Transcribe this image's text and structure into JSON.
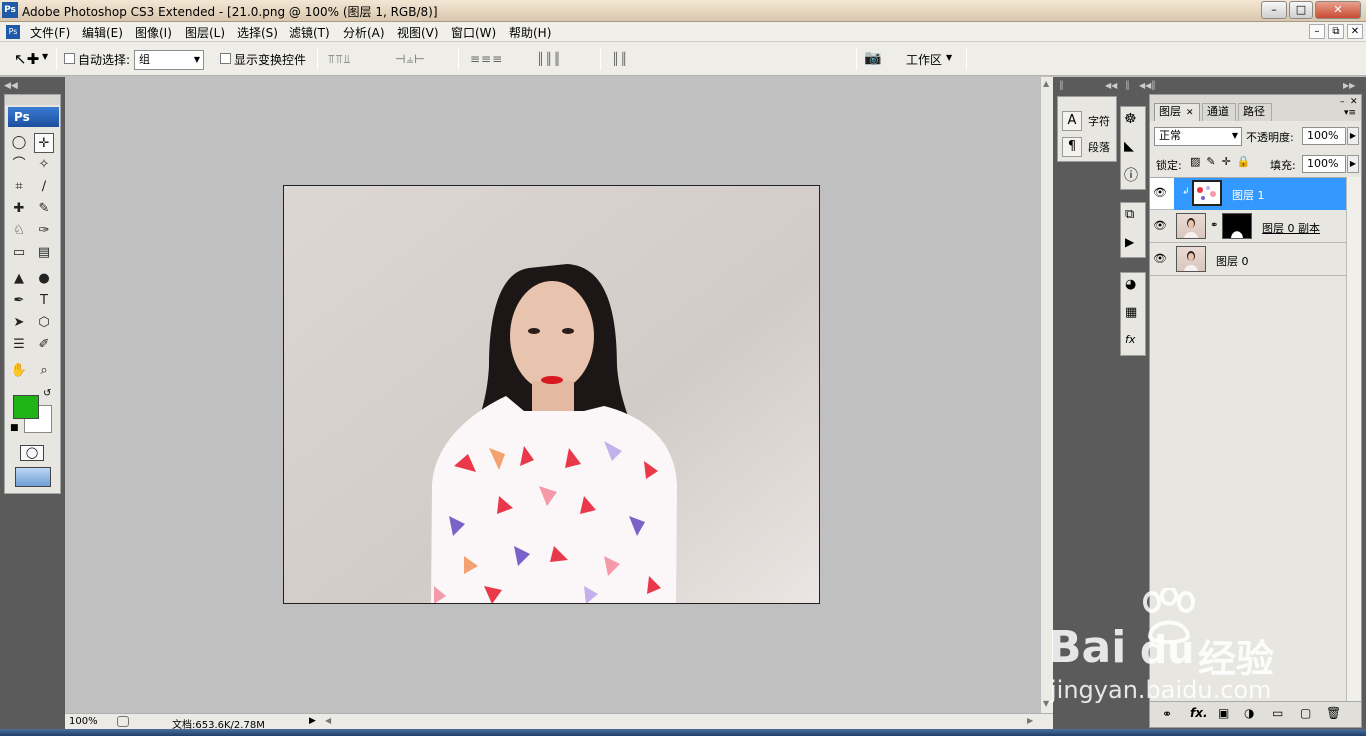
{
  "window": {
    "title": "Adobe Photoshop CS3 Extended - [21.0.png @ 100% (图层 1, RGB/8)]",
    "minimize": "–",
    "maximize": "□",
    "close": "✕"
  },
  "menu": [
    "文件(F)",
    "编辑(E)",
    "图像(I)",
    "图层(L)",
    "选择(S)",
    "滤镜(T)",
    "分析(A)",
    "视图(V)",
    "窗口(W)",
    "帮助(H)"
  ],
  "doc_controls": {
    "minimize": "–",
    "restore": "⧉",
    "close": "✕"
  },
  "options": {
    "auto_select_label": "自动选择:",
    "auto_select_value": "组",
    "show_transform_label": "显示变换控件",
    "workspace_label": "工作区"
  },
  "toolbox": {
    "ps_label": "Ps"
  },
  "tool_icons": [
    "marquee-icon",
    "move-icon",
    "lasso-icon",
    "magic-wand-icon",
    "crop-icon",
    "slice-icon",
    "healing-icon",
    "brush-icon",
    "stamp-icon",
    "history-brush-icon",
    "eraser-icon",
    "gradient-icon",
    "blur-icon",
    "dodge-icon",
    "pen-icon",
    "type-icon",
    "path-select-icon",
    "shape-icon",
    "notes-icon",
    "eyedropper-icon",
    "hand-icon",
    "zoom-icon"
  ],
  "colors": {
    "foreground": "#1fb316",
    "background": "#ffffff",
    "selection": "#3399ff"
  },
  "status": {
    "zoom": "100%",
    "doc_info": "文档:653.6K/2.78M"
  },
  "side_panel": {
    "character": "字符",
    "paragraph": "段落"
  },
  "layers_panel": {
    "tabs": [
      "图层",
      "通道",
      "路径"
    ],
    "blend_mode": "正常",
    "opacity_label": "不透明度:",
    "opacity_value": "100%",
    "lock_label": "锁定:",
    "fill_label": "填充:",
    "fill_value": "100%",
    "layers": [
      {
        "name": "图层 1",
        "selected": true
      },
      {
        "name": "图层 0 副本",
        "selected": false
      },
      {
        "name": "图层 0",
        "selected": false
      }
    ],
    "footer_icons": [
      "link-icon",
      "fx-icon",
      "mask-icon",
      "adjustment-icon",
      "group-icon",
      "new-layer-icon",
      "trash-icon"
    ]
  },
  "watermark": {
    "brand": "Bai",
    "brand_cn": "经验",
    "url": "jingyan.baidu.com"
  }
}
